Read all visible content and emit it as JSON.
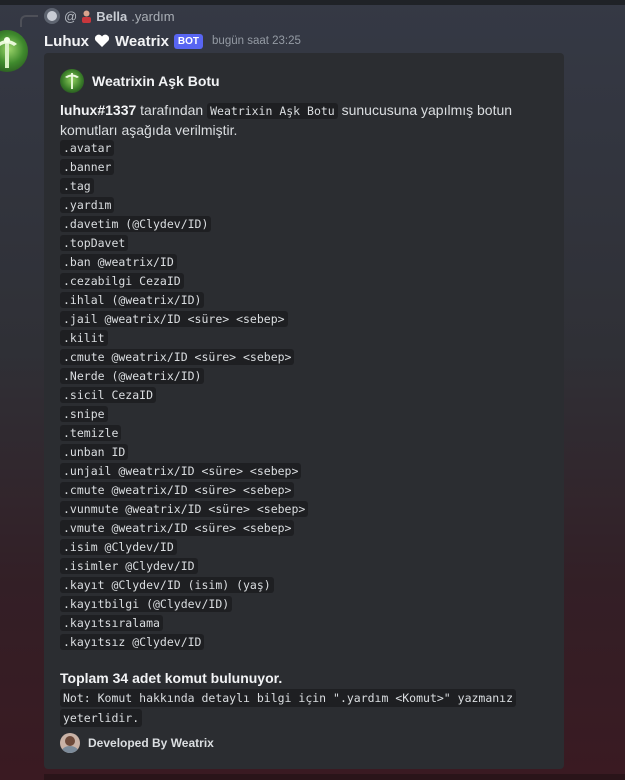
{
  "reply": {
    "at": "@",
    "name": "Bella",
    "text": ".yardım"
  },
  "message": {
    "username": "Luhux",
    "username_suffix": "Weatrix",
    "bot_tag": "BOT",
    "timestamp": "bugün saat 23:25"
  },
  "embed": {
    "author": "Weatrixin Aşk Botu",
    "description": {
      "user": "luhux#1337",
      "part1": " tarafından ",
      "server": "Weatrixin Aşk Botu",
      "part2": " sunucusuna yapılmış botun komutları aşağıda verilmiştir."
    },
    "commands": [
      ".avatar",
      ".banner",
      ".tag",
      ".yardım",
      ".davetim (@Clydev/ID)",
      ".topDavet",
      ".ban @weatrix/ID",
      ".cezabilgi CezaID",
      ".ihlal (@weatrix/ID)",
      ".jail @weatrix/ID <süre> <sebep>",
      ".kilit",
      ".cmute @weatrix/ID <süre> <sebep>",
      ".Nerde (@weatrix/ID)",
      ".sicil CezaID",
      ".snipe",
      ".temizle",
      ".unban ID",
      ".unjail @weatrix/ID <süre> <sebep>",
      ".cmute @weatrix/ID <süre> <sebep>",
      ".vunmute @weatrix/ID <süre> <sebep>",
      ".vmute @weatrix/ID <süre> <sebep>",
      ".isim @Clydev/ID",
      ".isimler @Clydev/ID",
      ".kayıt @Clydev/ID (isim) (yaş)",
      ".kayıtbilgi (@Clydev/ID)",
      ".kayıtsıralama",
      ".kayıtsız @Clydev/ID"
    ],
    "total": "Toplam 34 adet komut bulunuyor.",
    "note_line1": "Not: Komut hakkında detaylı bilgi için \".yardım <Komut>\" yazmanız",
    "note_line2": "yeterlidir.",
    "footer": "Developed By Weatrix"
  },
  "colors": {
    "accent": "#5865f2",
    "embed_bg": "#2b2d31",
    "code_bg": "#1e1f22"
  }
}
